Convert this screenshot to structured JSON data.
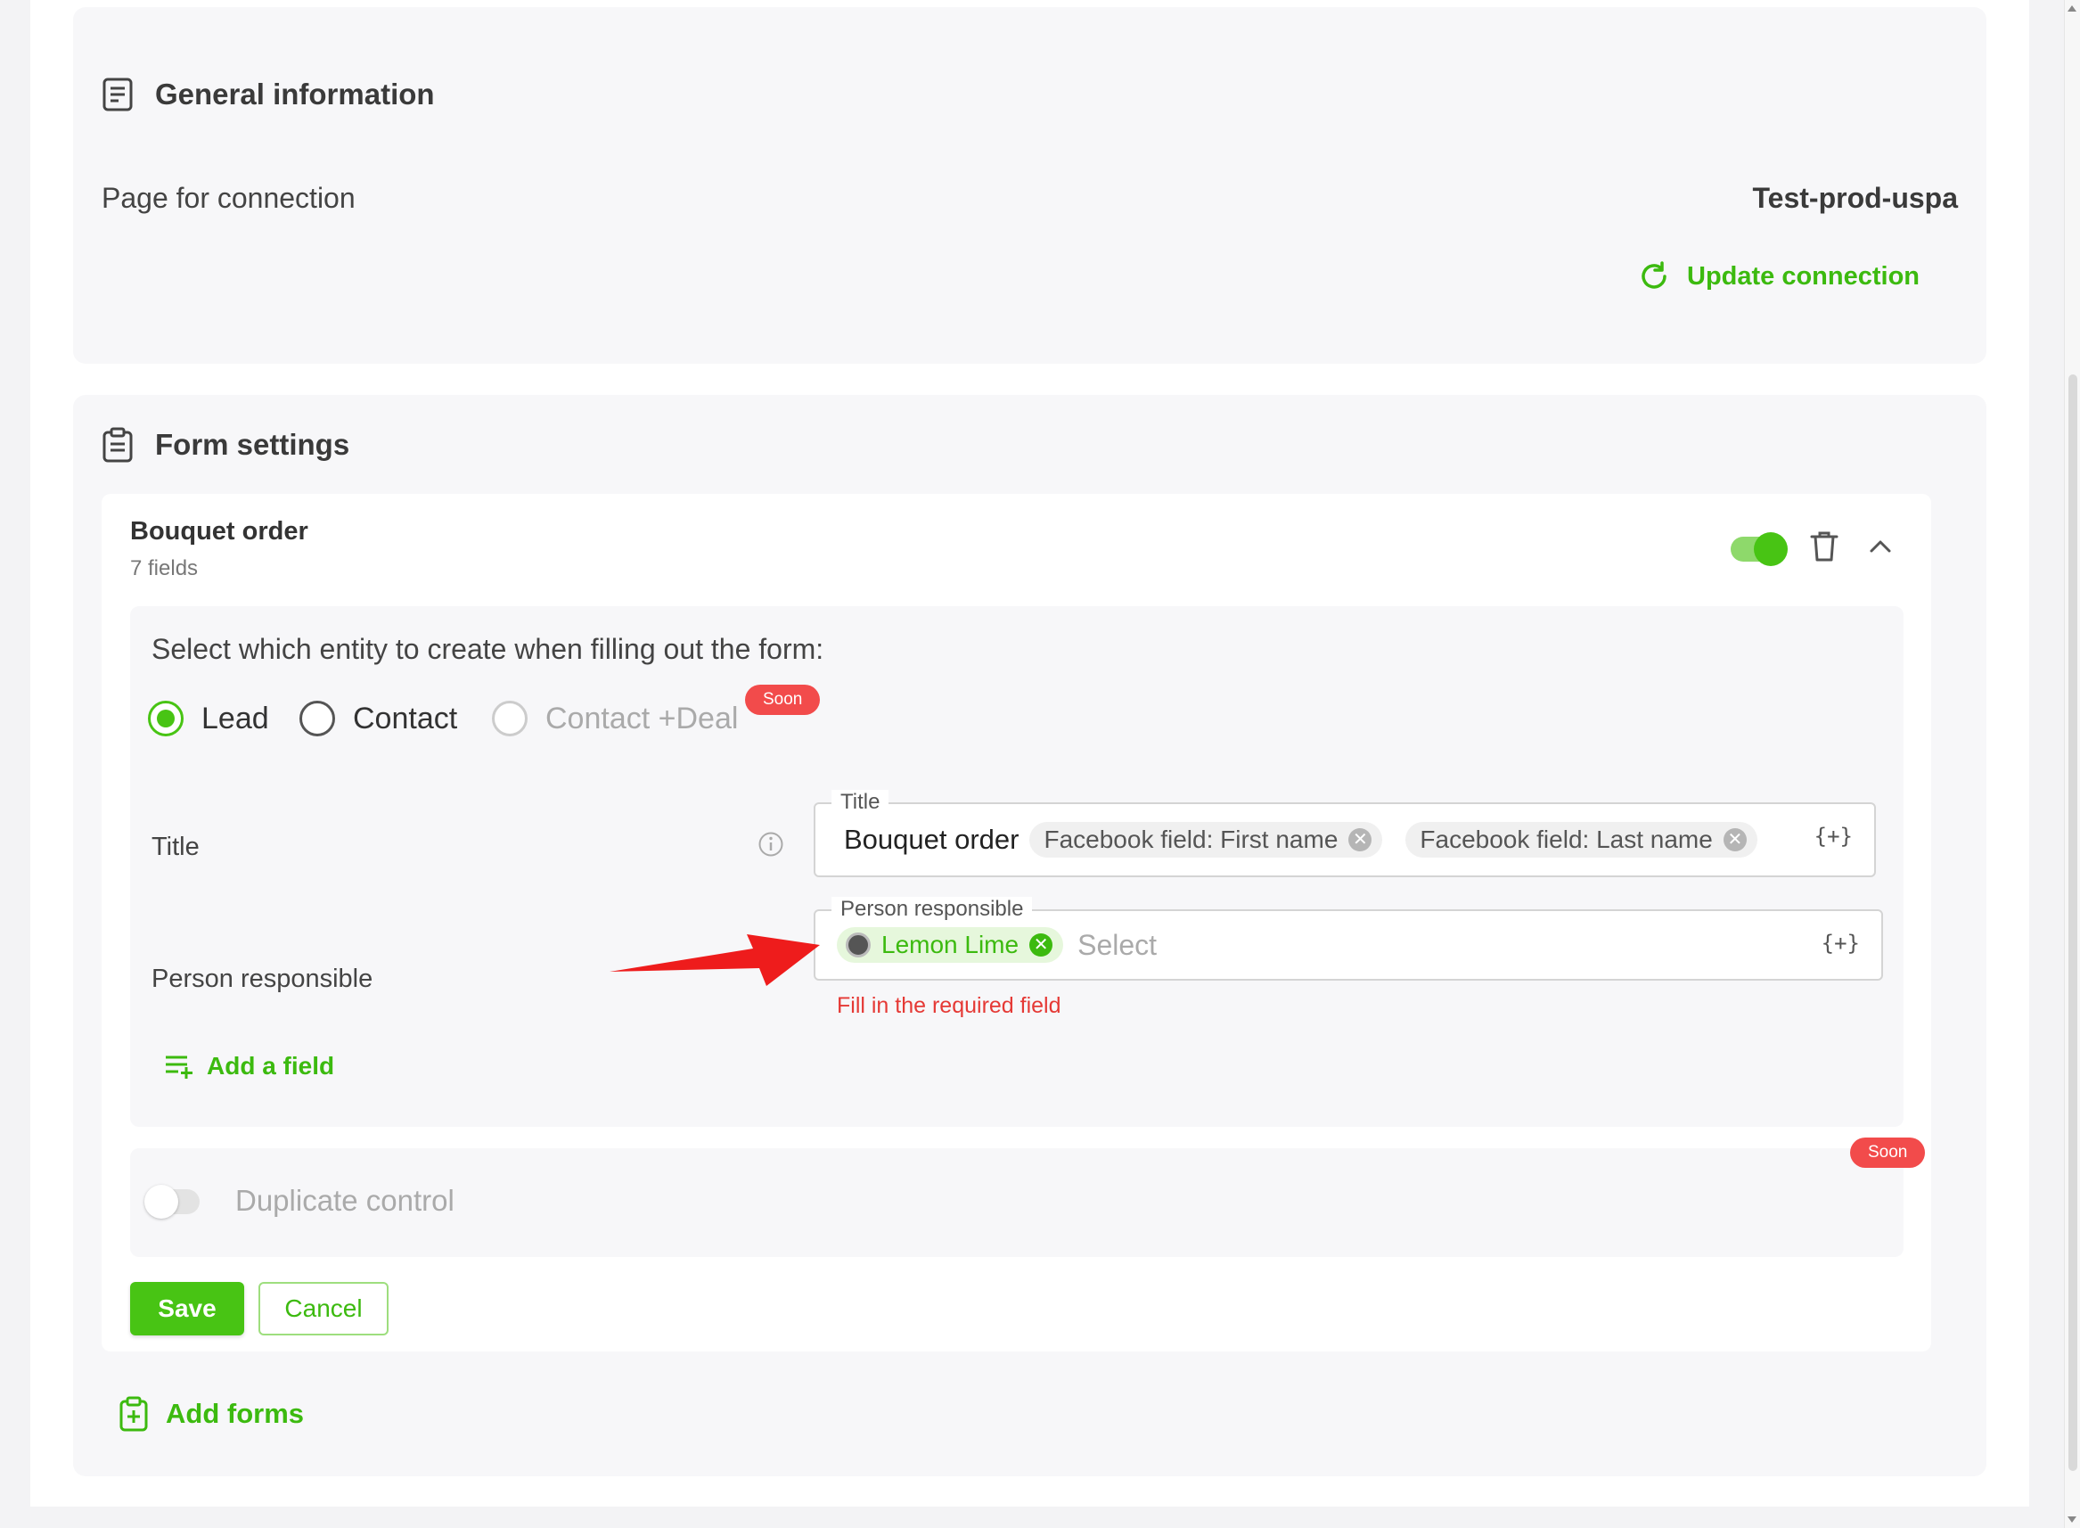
{
  "general": {
    "title": "General information",
    "page_label": "Page for connection",
    "page_value": "Test-prod-uspa",
    "update_label": "Update connection"
  },
  "form_settings": {
    "title": "Form settings",
    "form": {
      "name": "Bouquet order",
      "field_count": "7 fields",
      "enabled": true,
      "entity_question": "Select which entity to create when filling out the form:",
      "entities": [
        {
          "label": "Lead",
          "selected": true,
          "disabled": false
        },
        {
          "label": "Contact",
          "selected": false,
          "disabled": false
        },
        {
          "label": "Contact +Deal",
          "selected": false,
          "disabled": true
        }
      ],
      "soon_badge": "Soon",
      "title_field": {
        "row_label": "Title",
        "legend": "Title",
        "text": "Bouquet order",
        "chips": [
          "Facebook field: First name",
          "Facebook field: Last name"
        ],
        "var_icon": "{+}"
      },
      "person_field": {
        "row_label": "Person responsible",
        "legend": "Person responsible",
        "chip": "Lemon Lime",
        "placeholder": "Select",
        "var_icon": "{+}",
        "error": "Fill in the required field"
      },
      "add_field_label": "Add a field",
      "duplicate_control_label": "Duplicate control",
      "duplicate_soon": "Soon",
      "save_label": "Save",
      "cancel_label": "Cancel"
    },
    "add_forms_label": "Add forms"
  },
  "colors": {
    "accent": "#48c414",
    "error": "#e53935",
    "badge": "#f24b4b"
  },
  "icons": {
    "general": "document-icon",
    "form": "clipboard-icon",
    "update": "refresh-icon",
    "trash": "trash-icon",
    "collapse": "chevron-up-icon",
    "info": "info-icon",
    "add_field": "list-add-icon",
    "add_forms": "clipboard-plus-icon",
    "annotation": "red-arrow-icon"
  }
}
